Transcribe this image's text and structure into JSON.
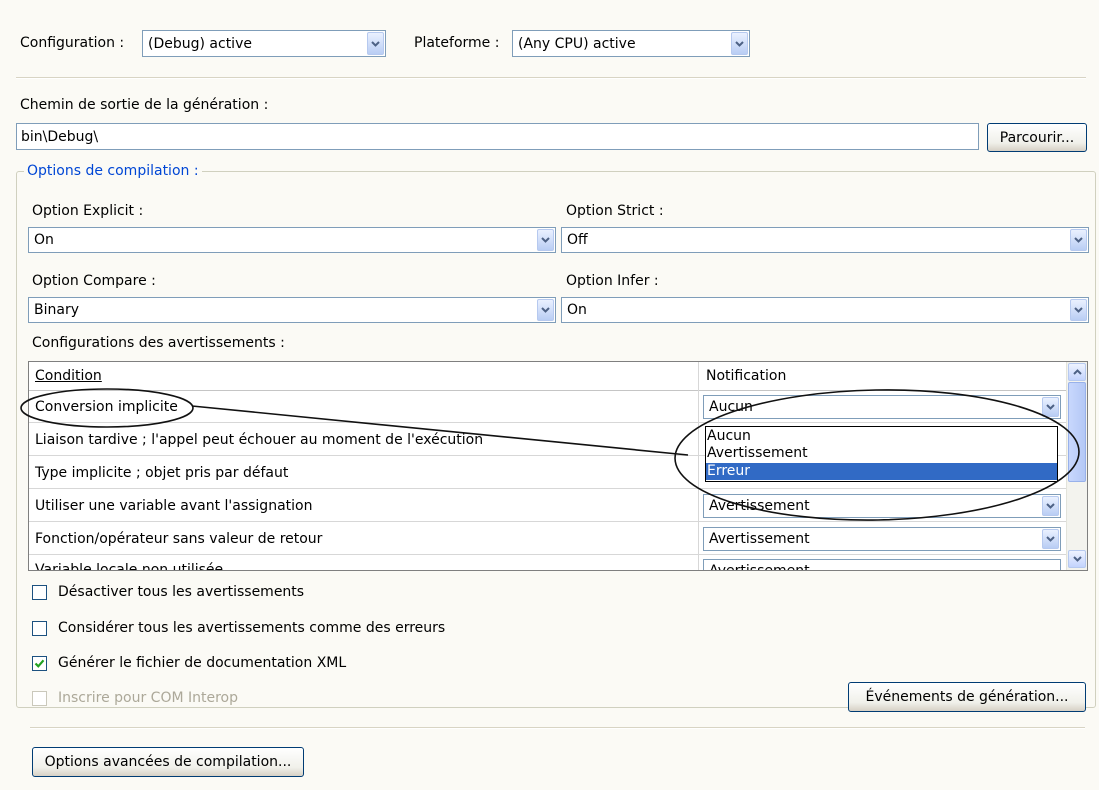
{
  "top": {
    "configuration_label": "Configuration :",
    "configuration_value": "(Debug) active",
    "platform_label": "Plateforme :",
    "platform_value": "(Any CPU) active"
  },
  "output": {
    "label": "Chemin de sortie de la génération :",
    "path_value": "bin\\Debug\\",
    "browse_button": "Parcourir..."
  },
  "compile": {
    "group_title": "Options de compilation :",
    "option_explicit_label": "Option Explicit :",
    "option_explicit_value": "On",
    "option_strict_label": "Option Strict :",
    "option_strict_value": "Off",
    "option_compare_label": "Option Compare :",
    "option_compare_value": "Binary",
    "option_infer_label": "Option Infer :",
    "option_infer_value": "On",
    "warnings_label": "Configurations des avertissements :"
  },
  "grid": {
    "col_condition": "Condition",
    "col_notification": "Notification",
    "rows": [
      {
        "condition": "Conversion implicite",
        "notification": "Aucun"
      },
      {
        "condition": "Liaison tardive ; l'appel peut échouer au moment de l'exécution",
        "notification": ""
      },
      {
        "condition": "Type implicite ; objet pris par défaut",
        "notification": ""
      },
      {
        "condition": "Utiliser une variable avant l'assignation",
        "notification": "Avertissement"
      },
      {
        "condition": "Fonction/opérateur sans valeur de retour",
        "notification": "Avertissement"
      },
      {
        "condition": "Variable locale non utilisée",
        "notification": "Avertissement"
      }
    ],
    "dropdown_options": [
      "Aucun",
      "Avertissement",
      "Erreur"
    ],
    "dropdown_selected": "Erreur"
  },
  "checkboxes": {
    "disable_all_warnings": {
      "label": "Désactiver tous les avertissements",
      "checked": false
    },
    "warnings_as_errors": {
      "label": "Considérer tous les avertissements comme des erreurs",
      "checked": false
    },
    "generate_xml_doc": {
      "label": "Générer le fichier de documentation XML",
      "checked": true
    },
    "register_com_interop": {
      "label": "Inscrire pour COM Interop",
      "checked": false,
      "enabled": false
    }
  },
  "buttons": {
    "build_events": "Événements de génération...",
    "advanced_compile": "Options avancées de compilation..."
  },
  "colors": {
    "background": "#fbfaf5",
    "group_title": "#0046d5",
    "selection": "#316ac5",
    "field_border": "#7f9db9"
  }
}
